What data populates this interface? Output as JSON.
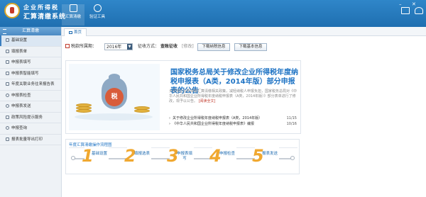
{
  "app": {
    "title_line1": "企业所得税",
    "title_line2": "汇算清缴系统"
  },
  "toolbar": [
    {
      "label": "汇算清缴",
      "icon": "grid-icon"
    },
    {
      "label": "验证工具",
      "icon": "tools-icon"
    }
  ],
  "sidebar": {
    "header": "汇算清缴",
    "items": [
      {
        "label": "基础设置",
        "icon": "settings-icon"
      },
      {
        "label": "填报表单",
        "icon": "form-icon"
      },
      {
        "label": "申报表填写",
        "icon": "edit-icon"
      },
      {
        "label": "申报表智能填写",
        "icon": "smart-edit-icon"
      },
      {
        "label": "年度关联业务往来报告表",
        "icon": "report-icon"
      },
      {
        "label": "申报表检查",
        "icon": "check-icon"
      },
      {
        "label": "申报表发送",
        "icon": "send-icon"
      },
      {
        "label": "政策风险提示服务",
        "icon": "warning-icon"
      },
      {
        "label": "申报查询",
        "icon": "search-icon"
      },
      {
        "label": "报表批量导出打印",
        "icon": "print-icon"
      }
    ]
  },
  "tab": {
    "label": "首页"
  },
  "filter": {
    "period_label": "税款所属期：",
    "period_value": "2016年",
    "mode_label": "征收方式：",
    "mode_value": "查账征收",
    "modify_link": "[修改]",
    "btn_taxpayer": "下载纳税信息",
    "btn_basic": "下载基本信息"
  },
  "notice": {
    "title": "国家税务总局关于修改企业所得税年度纳税申报表（A类，2014年版）部分申报表的公告",
    "summary": "为贯彻企业所得税汇算清缴相关政策，减轻纳税人申报负担，国家税务总局对《中华人民共和国企业所得税年度纳税申报表（A类，2014年版）》部分表单进行了修改，现予以公告。",
    "more": "[阅读全文]",
    "seal_char": "税",
    "links": [
      {
        "text": "关于修改企业所得税年度纳税申报表（A类，2014年版）",
        "date": "11/15"
      },
      {
        "text": "《中华人民共和国企业所得税年度纳税申报表》编报",
        "date": "10/16"
      }
    ]
  },
  "flow": {
    "title": "年度汇算清缴操作流程图",
    "steps": [
      {
        "num": "1",
        "label": "基础设置"
      },
      {
        "num": "2",
        "label": "填报选表"
      },
      {
        "num": "3",
        "label": "申报表填写"
      },
      {
        "num": "4",
        "label": "申报检查"
      },
      {
        "num": "5",
        "label": "报表发送"
      }
    ]
  },
  "colors": {
    "header_blue": "#2a7dc0",
    "title_blue": "#1e73c4",
    "step_orange": "#f0a830",
    "seal_red": "#d85c3a"
  }
}
